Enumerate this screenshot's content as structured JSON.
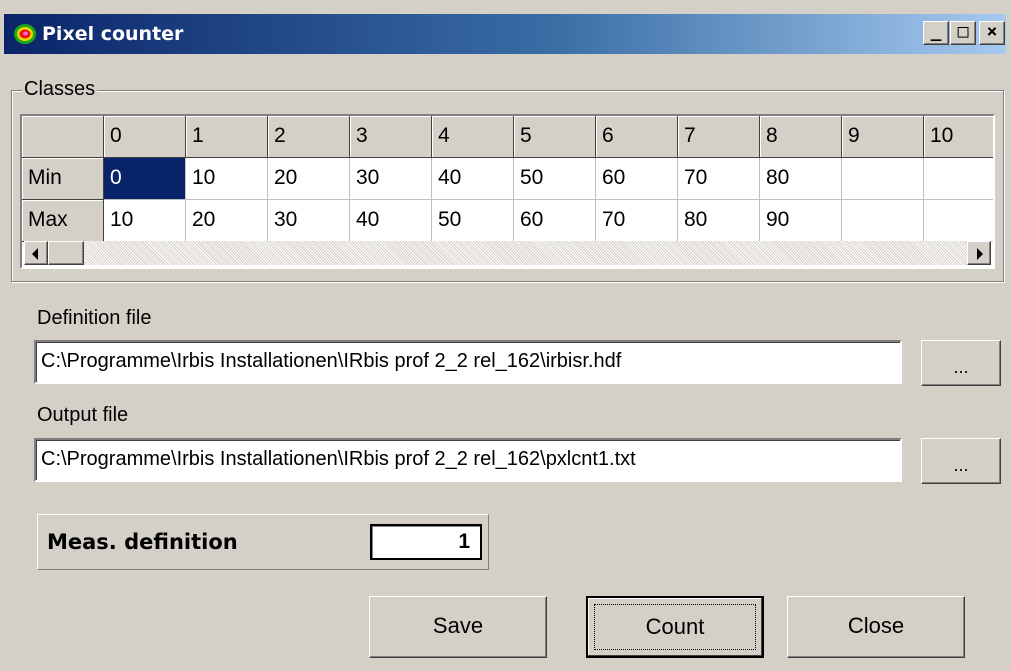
{
  "window": {
    "title": "Pixel counter",
    "controls": {
      "minimize": "_",
      "maximize": "□",
      "close": "×"
    }
  },
  "classes": {
    "group_label": "Classes",
    "columns": [
      "0",
      "1",
      "2",
      "3",
      "4",
      "5",
      "6",
      "7",
      "8",
      "9",
      "10"
    ],
    "rows": [
      {
        "label": "Min",
        "values": [
          "0",
          "10",
          "20",
          "30",
          "40",
          "50",
          "60",
          "70",
          "80",
          "",
          ""
        ]
      },
      {
        "label": "Max",
        "values": [
          "10",
          "20",
          "30",
          "40",
          "50",
          "60",
          "70",
          "80",
          "90",
          "",
          ""
        ]
      }
    ],
    "selected_cell": {
      "row": "Min",
      "column": "0"
    }
  },
  "definition_file": {
    "label": "Definition file",
    "value": "C:\\Programme\\Irbis Installationen\\IRbis prof 2_2 rel_162\\irbisr.hdf",
    "browse_label": "..."
  },
  "output_file": {
    "label": "Output file",
    "value": "C:\\Programme\\Irbis Installationen\\IRbis prof 2_2 rel_162\\pxlcnt1.txt",
    "browse_label": "..."
  },
  "meas_definition": {
    "label": "Meas. definition",
    "value": "1"
  },
  "buttons": {
    "save": "Save",
    "count": "Count",
    "close": "Close"
  },
  "colors": {
    "titlebar_start": "#0a246a",
    "titlebar_end": "#a6caf0",
    "face": "#d4d0c8",
    "selection": "#0a246a"
  },
  "icons": {
    "app": "thermal-blob-icon",
    "scroll_left": "arrow-left-icon",
    "scroll_right": "arrow-right-icon"
  }
}
